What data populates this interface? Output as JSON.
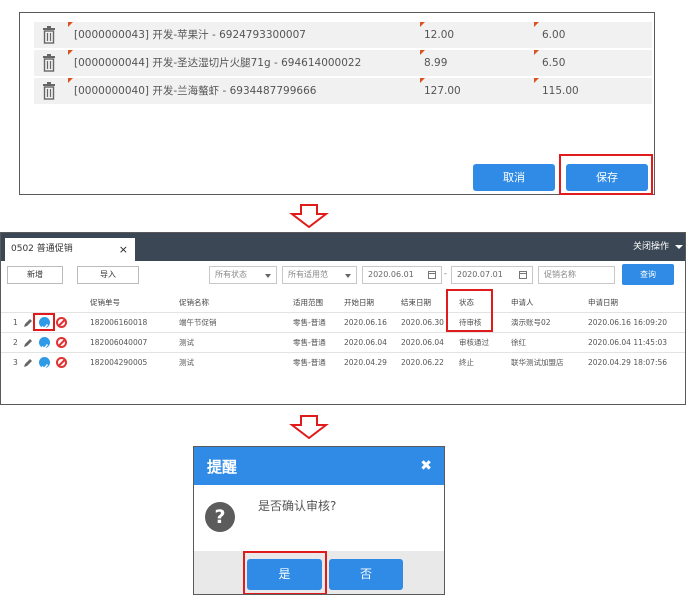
{
  "product_list": {
    "rows": [
      {
        "name": "[0000000043] 开发-苹果汁 - 6924793300007",
        "price": "12.00",
        "promo_price": "6.00"
      },
      {
        "name": "[0000000044] 开发-圣达湿切片火腿71g - 694614000022",
        "price": "8.99",
        "promo_price": "6.50"
      },
      {
        "name": "[0000000040] 开发-兰海螯虾 - 6934487799666",
        "price": "127.00",
        "promo_price": "115.00"
      }
    ],
    "cancel_label": "取消",
    "save_label": "保存"
  },
  "promo_page": {
    "tab_label": "0502 普通促销",
    "tab_close": "×",
    "close_ops_label": "关闭操作",
    "new_label": "新增",
    "import_label": "导入",
    "status_filter": "所有状态",
    "scope_filter": "所有适用范",
    "start_date": "2020.06.01",
    "date_separator": "-",
    "end_date": "2020.07.01",
    "name_placeholder": "促销名称",
    "search_label": "查询",
    "columns": [
      "促销单号",
      "促销名称",
      "适用范围",
      "开始日期",
      "结束日期",
      "状态",
      "申请人",
      "申请日期"
    ],
    "rows": [
      {
        "num": "1",
        "code": "182006160018",
        "name": "端午节促销",
        "scope": "零售-普通",
        "start": "2020.06.16",
        "end": "2020.06.30",
        "status": "待审核",
        "applicant": "演示账号02",
        "apply_date": "2020.06.16 16:09:20"
      },
      {
        "num": "2",
        "code": "182006040007",
        "name": "测试",
        "scope": "零售-普通",
        "start": "2020.06.04",
        "end": "2020.06.04",
        "status": "审核通过",
        "applicant": "徐红",
        "apply_date": "2020.06.04 11:45:03"
      },
      {
        "num": "3",
        "code": "182004290005",
        "name": "测试",
        "scope": "零售-普通",
        "start": "2020.04.29",
        "end": "2020.06.22",
        "status": "终止",
        "applicant": "联华测试加盟店",
        "apply_date": "2020.04.29 18:07:56"
      }
    ]
  },
  "dialog": {
    "title": "提醒",
    "close_glyph": "✖",
    "question_glyph": "?",
    "message": "是否确认审核?",
    "yes_label": "是",
    "no_label": "否"
  },
  "colors": {
    "accent_blue": "#2f8be6",
    "highlight_red": "#e01b1b",
    "tab_bar": "#3c4756",
    "approve_icon": "#2f9be8",
    "ban_icon": "#e23232"
  },
  "icons": [
    "trash-icon",
    "edit-icon",
    "approve-icon",
    "ban-icon",
    "down-arrow-icon",
    "question-icon",
    "close-icon",
    "calendar-icon",
    "caret-down-icon"
  ]
}
